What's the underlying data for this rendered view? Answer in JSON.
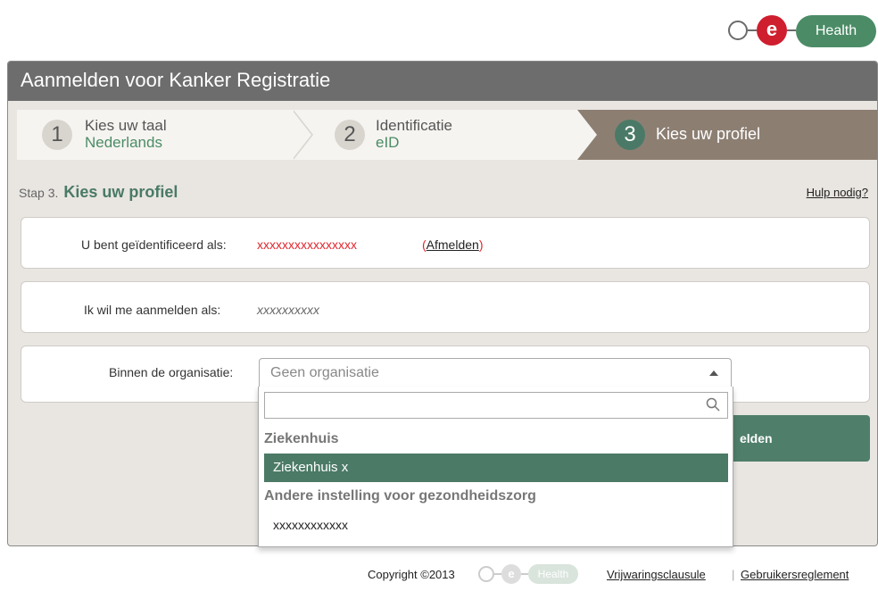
{
  "logo": {
    "letter": "e",
    "word": "Health"
  },
  "panel": {
    "title": "Aanmelden voor Kanker Registratie"
  },
  "steps": [
    {
      "number": "1",
      "title": "Kies uw taal",
      "value": "Nederlands"
    },
    {
      "number": "2",
      "title": "Identificatie",
      "value": "eID"
    },
    {
      "number": "3",
      "title": "Kies uw profiel"
    }
  ],
  "stap": {
    "prefix": "Stap 3.",
    "title": "Kies uw profiel"
  },
  "help_link": "Hulp nodig?",
  "identification": {
    "label": "U bent geïdentificeerd als:",
    "value": "xxxxxxxxxxxxxxxx",
    "open_paren": "(",
    "logout": "Afmelden",
    "close_paren": ")"
  },
  "profile": {
    "label": "Ik wil me aanmelden als:",
    "value": "xxxxxxxxxx"
  },
  "organisation": {
    "label": "Binnen de organisatie:",
    "selected": "Geen organisatie"
  },
  "dropdown": {
    "search_value": "",
    "groups": [
      {
        "label": "Ziekenhuis",
        "options": [
          "Ziekenhuis x"
        ]
      },
      {
        "label": "Andere instelling voor gezondheidszorg",
        "options": [
          "xxxxxxxxxxxx"
        ]
      }
    ],
    "highlighted": "Ziekenhuis x"
  },
  "submit_partial": "elden",
  "footer": {
    "copyright": "Copyright ©2013",
    "logo_letter": "e",
    "logo_word": "Health",
    "link1": "Vrijwaringsclausule",
    "separator": "|",
    "link2": "Gebruikersreglement"
  }
}
